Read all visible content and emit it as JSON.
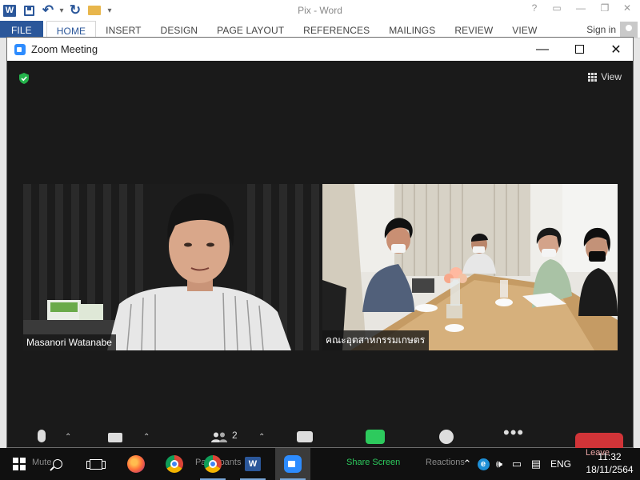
{
  "word": {
    "title": "Pix - Word",
    "help": "?",
    "tabs": [
      "FILE",
      "HOME",
      "INSERT",
      "DESIGN",
      "PAGE LAYOUT",
      "REFERENCES",
      "MAILINGS",
      "REVIEW",
      "VIEW"
    ],
    "active_tab": "HOME",
    "sign_in": "Sign in"
  },
  "zoom": {
    "window_title": "Zoom Meeting",
    "view_label": "View",
    "participants": [
      {
        "name": "Masanori Watanabe"
      },
      {
        "name": "คณะอุตสาหกรรมเกษตร"
      }
    ],
    "toolbar": {
      "mute": "Mute",
      "video": "Stop Video",
      "participants": "Participants",
      "participant_count": "2",
      "share": "Share Screen",
      "reactions": "Reactions",
      "leave": "Leave"
    },
    "accent": "#2d8cff",
    "share_green": "#2dca5d",
    "leave_red": "#d13438"
  },
  "taskbar": {
    "language": "ENG",
    "time": "11:32",
    "date": "18/11/2564"
  }
}
